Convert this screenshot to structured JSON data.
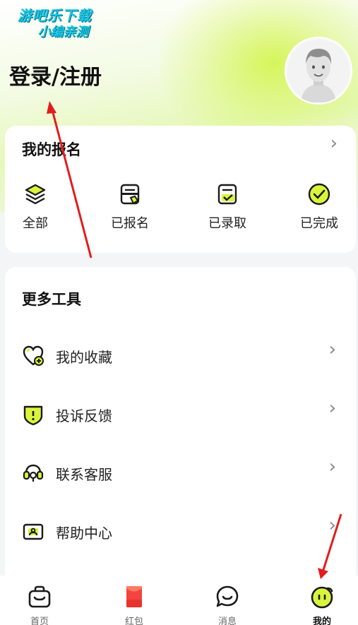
{
  "watermark": {
    "line1": "游吧乐下载",
    "line2": "小编亲测"
  },
  "header": {
    "login_label": "登录/注册"
  },
  "signup": {
    "title": "我的报名",
    "items": [
      {
        "label": "全部",
        "icon": "layers-icon"
      },
      {
        "label": "已报名",
        "icon": "signup-form-icon"
      },
      {
        "label": "已录取",
        "icon": "admitted-form-icon"
      },
      {
        "label": "已完成",
        "icon": "check-circle-icon"
      }
    ]
  },
  "tools": {
    "title": "更多工具",
    "items": [
      {
        "label": "我的收藏",
        "icon": "heart-plus-icon"
      },
      {
        "label": "投诉反馈",
        "icon": "shield-alert-icon"
      },
      {
        "label": "联系客服",
        "icon": "headset-icon"
      },
      {
        "label": "帮助中心",
        "icon": "id-card-icon"
      }
    ]
  },
  "tabbar": {
    "items": [
      {
        "label": "首页",
        "icon": "shopping-bag-icon",
        "active": false
      },
      {
        "label": "红包",
        "icon": "red-envelope-icon",
        "active": false
      },
      {
        "label": "消息",
        "icon": "chat-bubble-icon",
        "active": false
      },
      {
        "label": "我的",
        "icon": "smiley-face-icon",
        "active": true
      }
    ]
  },
  "colors": {
    "accent": "#d9f53b",
    "annotation_arrow": "#e21d1d",
    "text_primary": "#111111"
  }
}
